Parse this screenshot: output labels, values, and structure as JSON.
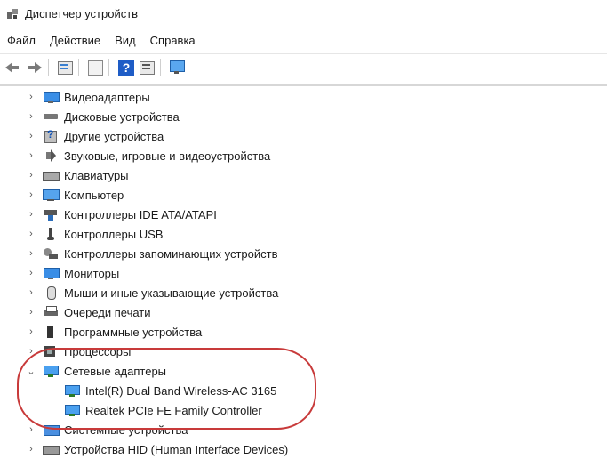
{
  "window": {
    "title": "Диспетчер устройств",
    "icon": "device-manager-icon"
  },
  "menu": {
    "items": [
      "Файл",
      "Действие",
      "Вид",
      "Справка"
    ]
  },
  "toolbar": {
    "buttons": [
      {
        "name": "back",
        "icon": "arrow-left-icon"
      },
      {
        "name": "forward",
        "icon": "arrow-right-icon"
      },
      {
        "name": "properties",
        "icon": "properties-icon"
      },
      {
        "name": "refresh",
        "icon": "refresh-icon"
      },
      {
        "name": "help",
        "icon": "help-icon"
      },
      {
        "name": "list",
        "icon": "list-icon"
      },
      {
        "name": "scan",
        "icon": "scan-hardware-icon"
      }
    ]
  },
  "tree": {
    "items": [
      {
        "label": "Видеоадаптеры",
        "icon": "display-adapter-icon",
        "expanded": false
      },
      {
        "label": "Дисковые устройства",
        "icon": "disk-drive-icon",
        "expanded": false
      },
      {
        "label": "Другие устройства",
        "icon": "unknown-device-icon",
        "expanded": false
      },
      {
        "label": "Звуковые, игровые и видеоустройства",
        "icon": "speaker-icon",
        "expanded": false
      },
      {
        "label": "Клавиатуры",
        "icon": "keyboard-icon",
        "expanded": false
      },
      {
        "label": "Компьютер",
        "icon": "computer-icon",
        "expanded": false
      },
      {
        "label": "Контроллеры IDE ATA/ATAPI",
        "icon": "ide-controller-icon",
        "expanded": false
      },
      {
        "label": "Контроллеры USB",
        "icon": "usb-icon",
        "expanded": false
      },
      {
        "label": "Контроллеры запоминающих устройств",
        "icon": "storage-controller-icon",
        "expanded": false
      },
      {
        "label": "Мониторы",
        "icon": "monitor-icon",
        "expanded": false
      },
      {
        "label": "Мыши и иные указывающие устройства",
        "icon": "mouse-icon",
        "expanded": false
      },
      {
        "label": "Очереди печати",
        "icon": "printer-icon",
        "expanded": false
      },
      {
        "label": "Программные устройства",
        "icon": "software-device-icon",
        "expanded": false
      },
      {
        "label": "Процессоры",
        "icon": "cpu-icon",
        "expanded": false
      },
      {
        "label": "Сетевые адаптеры",
        "icon": "network-adapter-icon",
        "expanded": true
      },
      {
        "label": "Intel(R) Dual Band Wireless-AC 3165",
        "icon": "network-adapter-icon",
        "child": true
      },
      {
        "label": "Realtek PCIe FE Family Controller",
        "icon": "network-adapter-icon",
        "child": true
      },
      {
        "label": "Системные устройства",
        "icon": "system-device-icon",
        "expanded": false
      },
      {
        "label": "Устройства HID (Human Interface Devices)",
        "icon": "hid-icon",
        "expanded": false
      }
    ]
  },
  "annotation": {
    "color": "#c83a3a"
  }
}
